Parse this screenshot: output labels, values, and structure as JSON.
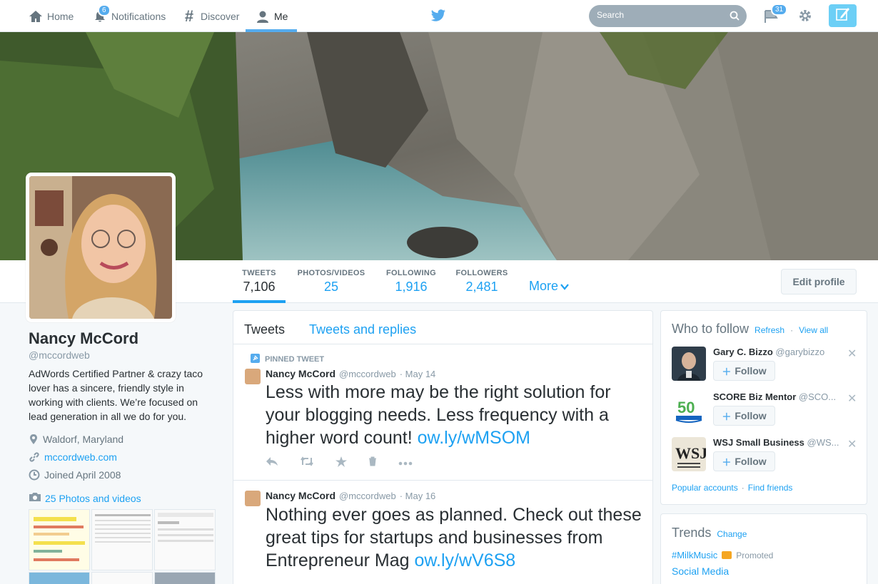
{
  "topnav": {
    "home": "Home",
    "notifications": "Notifications",
    "notifications_count": "6",
    "discover": "Discover",
    "me": "Me",
    "search_placeholder": "Search",
    "messages_count": "31"
  },
  "profile": {
    "name": "Nancy McCord",
    "handle": "@mccordweb",
    "bio": "AdWords Certified Partner & crazy taco lover has a sincere, friendly style in working with clients. We’re focused on lead generation in all we do for you.",
    "location": "Waldorf, Maryland",
    "website": "mccordweb.com",
    "joined": "Joined April 2008",
    "photos_link": "25 Photos and videos"
  },
  "stats": [
    {
      "label": "TWEETS",
      "value": "7,106"
    },
    {
      "label": "PHOTOS/VIDEOS",
      "value": "25"
    },
    {
      "label": "FOLLOWING",
      "value": "1,916"
    },
    {
      "label": "FOLLOWERS",
      "value": "2,481"
    }
  ],
  "more_label": "More",
  "edit_profile": "Edit profile",
  "timeline": {
    "tab_tweets": "Tweets",
    "tab_replies": "Tweets and replies",
    "pinned_label": "PINNED TWEET",
    "tweets": [
      {
        "name": "Nancy McCord",
        "handle": "@mccordweb",
        "date": "· May 14",
        "text": "Less with more may be the right solution for your blogging needs. Less frequency with a higher word count!",
        "link": "ow.ly/wMSOM"
      },
      {
        "name": "Nancy McCord",
        "handle": "@mccordweb",
        "date": "· May 16",
        "text": "Nothing ever goes as planned. Check out these great tips for startups and businesses from Entrepreneur Mag",
        "link": "ow.ly/wV6S8"
      }
    ]
  },
  "who_to_follow": {
    "title": "Who to follow",
    "refresh": "Refresh",
    "view_all": "View all",
    "follow_label": "Follow",
    "suggestions": [
      {
        "name": "Gary C. Bizzo",
        "handle": "@garybizzo"
      },
      {
        "name": "SCORE Biz Mentor",
        "handle": "@SCO..."
      },
      {
        "name": "WSJ Small Business",
        "handle": "@WS..."
      }
    ],
    "popular": "Popular accounts",
    "find_friends": "Find friends"
  },
  "trends": {
    "title": "Trends",
    "change": "Change",
    "items": [
      {
        "name": "#MilkMusic",
        "promoted": "Promoted"
      },
      {
        "name": "Social Media"
      }
    ]
  },
  "colors": {
    "accent": "#1da1f2",
    "brand": "#55acee"
  }
}
